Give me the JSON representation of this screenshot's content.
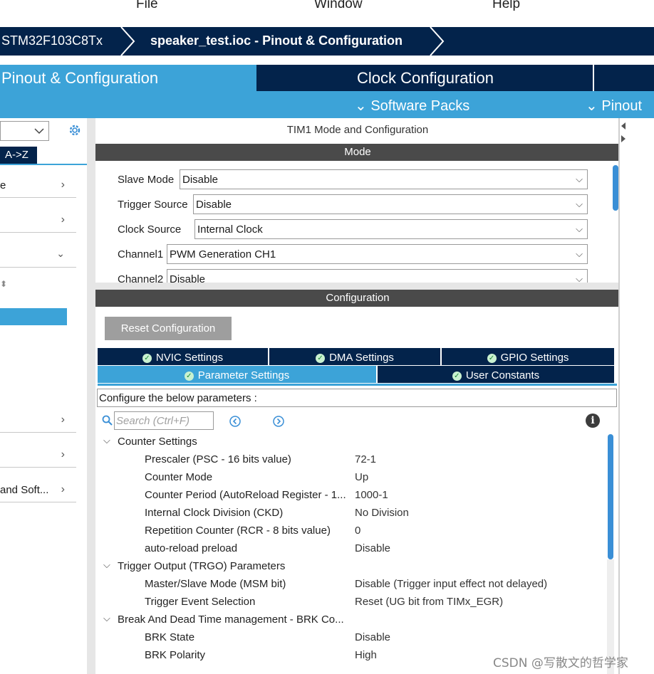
{
  "menu": {
    "file": "File",
    "window": "Window",
    "help": "Help"
  },
  "breadcrumb": {
    "device": "STM32F103C8Tx",
    "file": "speaker_test.ioc - Pinout & Configuration"
  },
  "tabs": {
    "pinout": "Pinout & Configuration",
    "clock": "Clock Configuration"
  },
  "subbar": {
    "software_packs": "Software Packs",
    "pinout": "Pinout"
  },
  "left": {
    "az_label": "A->Z",
    "rows": [
      "e",
      "",
      "",
      "",
      "",
      "and Soft..."
    ]
  },
  "panel": {
    "title": "TIM1 Mode and Configuration",
    "mode_header": "Mode",
    "config_header": "Configuration"
  },
  "mode": [
    {
      "label": "Slave Mode",
      "value": "Disable"
    },
    {
      "label": "Trigger Source",
      "value": "Disable"
    },
    {
      "label": "Clock Source",
      "value": "Internal Clock"
    },
    {
      "label": "Channel1",
      "value": "PWM Generation CH1"
    },
    {
      "label": "Channel2",
      "value": "Disable"
    }
  ],
  "config": {
    "reset_button": "Reset Configuration",
    "tabs_top": [
      "NVIC Settings",
      "DMA Settings",
      "GPIO Settings"
    ],
    "tab_param": "Parameter Settings",
    "tab_user": "User Constants",
    "hint": "Configure the below parameters :",
    "search_placeholder": "Search (Ctrl+F)"
  },
  "params": [
    {
      "group": "Counter Settings"
    },
    {
      "name": "Prescaler (PSC - 16 bits value)",
      "value": "72-1"
    },
    {
      "name": "Counter Mode",
      "value": "Up"
    },
    {
      "name": "Counter Period (AutoReload Register - 1...",
      "value": "1000-1"
    },
    {
      "name": "Internal Clock Division (CKD)",
      "value": "No Division"
    },
    {
      "name": "Repetition Counter (RCR - 8 bits value)",
      "value": "0"
    },
    {
      "name": "auto-reload preload",
      "value": "Disable"
    },
    {
      "group": "Trigger Output (TRGO) Parameters"
    },
    {
      "name": "Master/Slave Mode (MSM bit)",
      "value": "Disable (Trigger input effect not delayed)"
    },
    {
      "name": "Trigger Event Selection",
      "value": "Reset (UG bit from TIMx_EGR)"
    },
    {
      "group": "Break And Dead Time management - BRK Co..."
    },
    {
      "name": "BRK State",
      "value": "Disable"
    },
    {
      "name": "BRK Polarity",
      "value": "High"
    }
  ],
  "watermark": "CSDN @写散文的哲学家"
}
